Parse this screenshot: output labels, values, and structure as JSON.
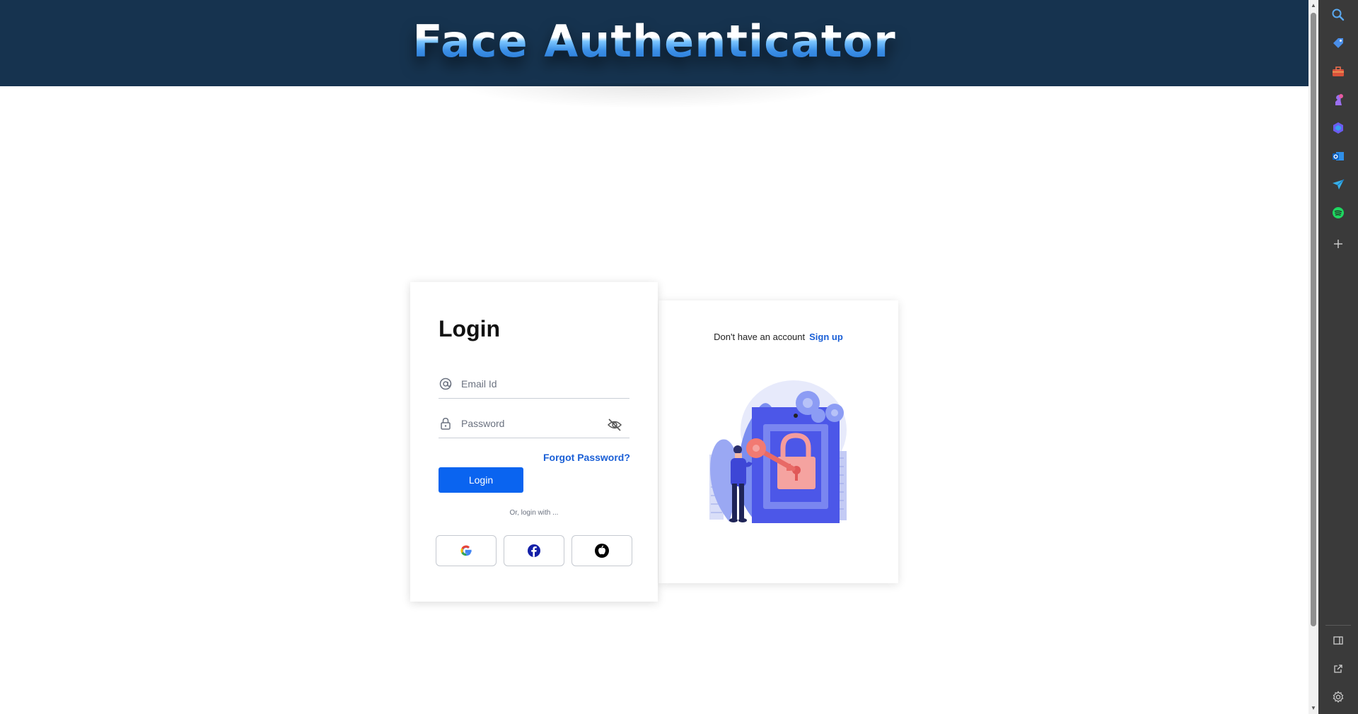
{
  "header": {
    "title": "Face Authenticator"
  },
  "login": {
    "title": "Login",
    "email_placeholder": "Email Id",
    "password_placeholder": "Password",
    "forgot_password": "Forgot Password?",
    "login_button": "Login",
    "or_text": "Or, login with ...",
    "social": [
      "google-icon",
      "facebook-icon",
      "apple-icon"
    ]
  },
  "signup": {
    "prompt": "Don't have an account",
    "link": "Sign up"
  },
  "sidebar": {
    "icons": [
      "search-icon",
      "tag-icon",
      "toolbox-icon",
      "chess-icon",
      "copilot-icon",
      "outlook-icon",
      "send-icon",
      "spotify-icon",
      "add-icon"
    ],
    "bottom_icons": [
      "sidebar-toggle-icon",
      "external-link-icon",
      "settings-icon"
    ]
  },
  "colors": {
    "header_bg": "#16334f",
    "accent": "#0a64f0",
    "link": "#1a5fd6",
    "sidebar_bg": "#3a3a3a"
  }
}
